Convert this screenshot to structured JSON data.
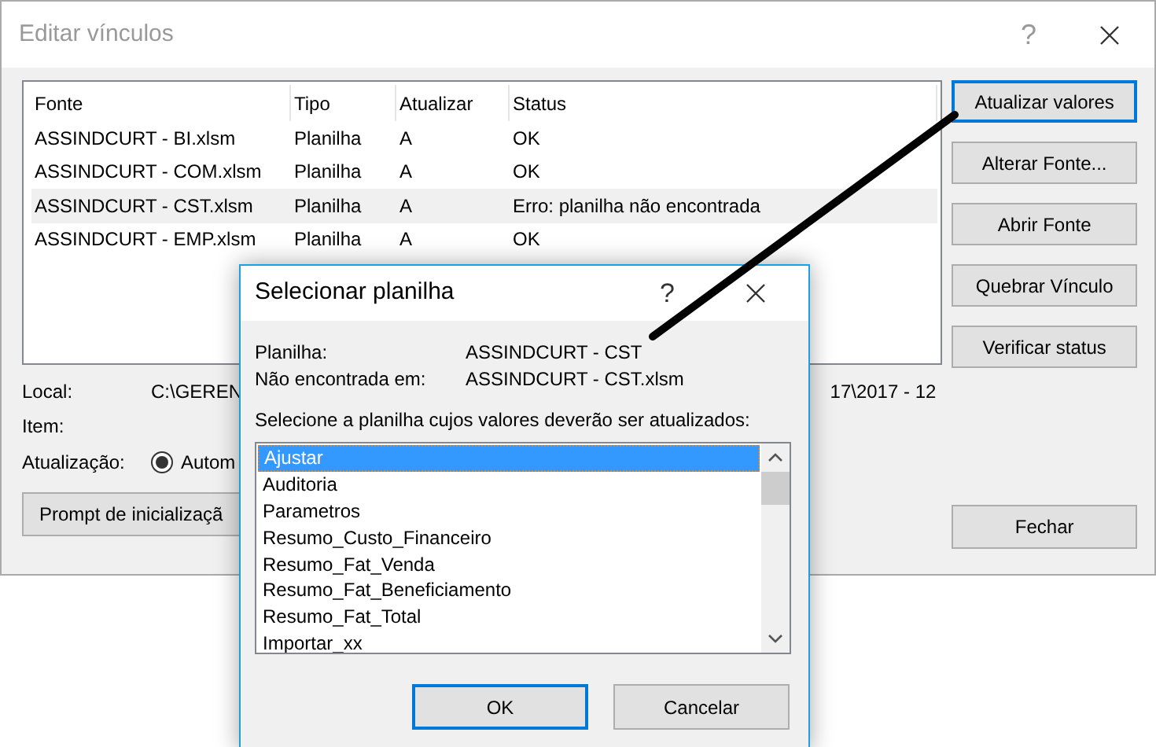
{
  "window": {
    "title": "Editar vínculos",
    "help": "?"
  },
  "links_table": {
    "columns": [
      "Fonte",
      "Tipo",
      "Atualizar",
      "Status"
    ],
    "rows": [
      {
        "cells": [
          "ASSINDCURT - BI.xlsm",
          "Planilha",
          "A",
          "OK"
        ],
        "selected": false
      },
      {
        "cells": [
          "ASSINDCURT - COM.xlsm",
          "Planilha",
          "A",
          "OK"
        ],
        "selected": false
      },
      {
        "cells": [
          "ASSINDCURT - CST.xlsm",
          "Planilha",
          "A",
          "Erro: planilha não encontrada"
        ],
        "selected": true
      },
      {
        "cells": [
          "ASSINDCURT - EMP.xlsm",
          "Planilha",
          "A",
          "OK"
        ],
        "selected": false
      }
    ]
  },
  "side_buttons": [
    {
      "label": "Atualizar valores",
      "focused": true
    },
    {
      "label": "Alterar Fonte...",
      "focused": false
    },
    {
      "label": "Abrir Fonte",
      "focused": false
    },
    {
      "label": "Quebrar Vínculo",
      "focused": false
    },
    {
      "label": "Verificar status",
      "focused": false
    }
  ],
  "details": {
    "local_label": "Local:",
    "local_value_start": "C:\\GEREN",
    "local_value_end": "17\\2017 - 12",
    "item_label": "Item:",
    "update_label": "Atualização:",
    "update_option": {
      "label": "Autom",
      "checked": true
    }
  },
  "prompt_button": "Prompt de inicializaçã",
  "close_button": "Fechar",
  "dialog": {
    "title": "Selecionar planilha",
    "help": "?",
    "sheet_label": "Planilha:",
    "sheet_value": "ASSINDCURT - CST",
    "not_found_label": "Não encontrada em:",
    "not_found_value": "ASSINDCURT - CST.xlsm",
    "prompt": "Selecione a planilha cujos valores deverão ser atualizados:",
    "sheets": [
      {
        "label": "Ajustar",
        "selected": true
      },
      {
        "label": "Auditoria",
        "selected": false
      },
      {
        "label": "Parametros",
        "selected": false
      },
      {
        "label": "Resumo_Custo_Financeiro",
        "selected": false
      },
      {
        "label": "Resumo_Fat_Venda",
        "selected": false
      },
      {
        "label": "Resumo_Fat_Beneficiamento",
        "selected": false
      },
      {
        "label": "Resumo_Fat_Total",
        "selected": false
      },
      {
        "label": "Importar_xx",
        "selected": false
      }
    ],
    "buttons": [
      {
        "label": "OK",
        "default": true
      },
      {
        "label": "Cancelar",
        "default": false
      }
    ]
  }
}
